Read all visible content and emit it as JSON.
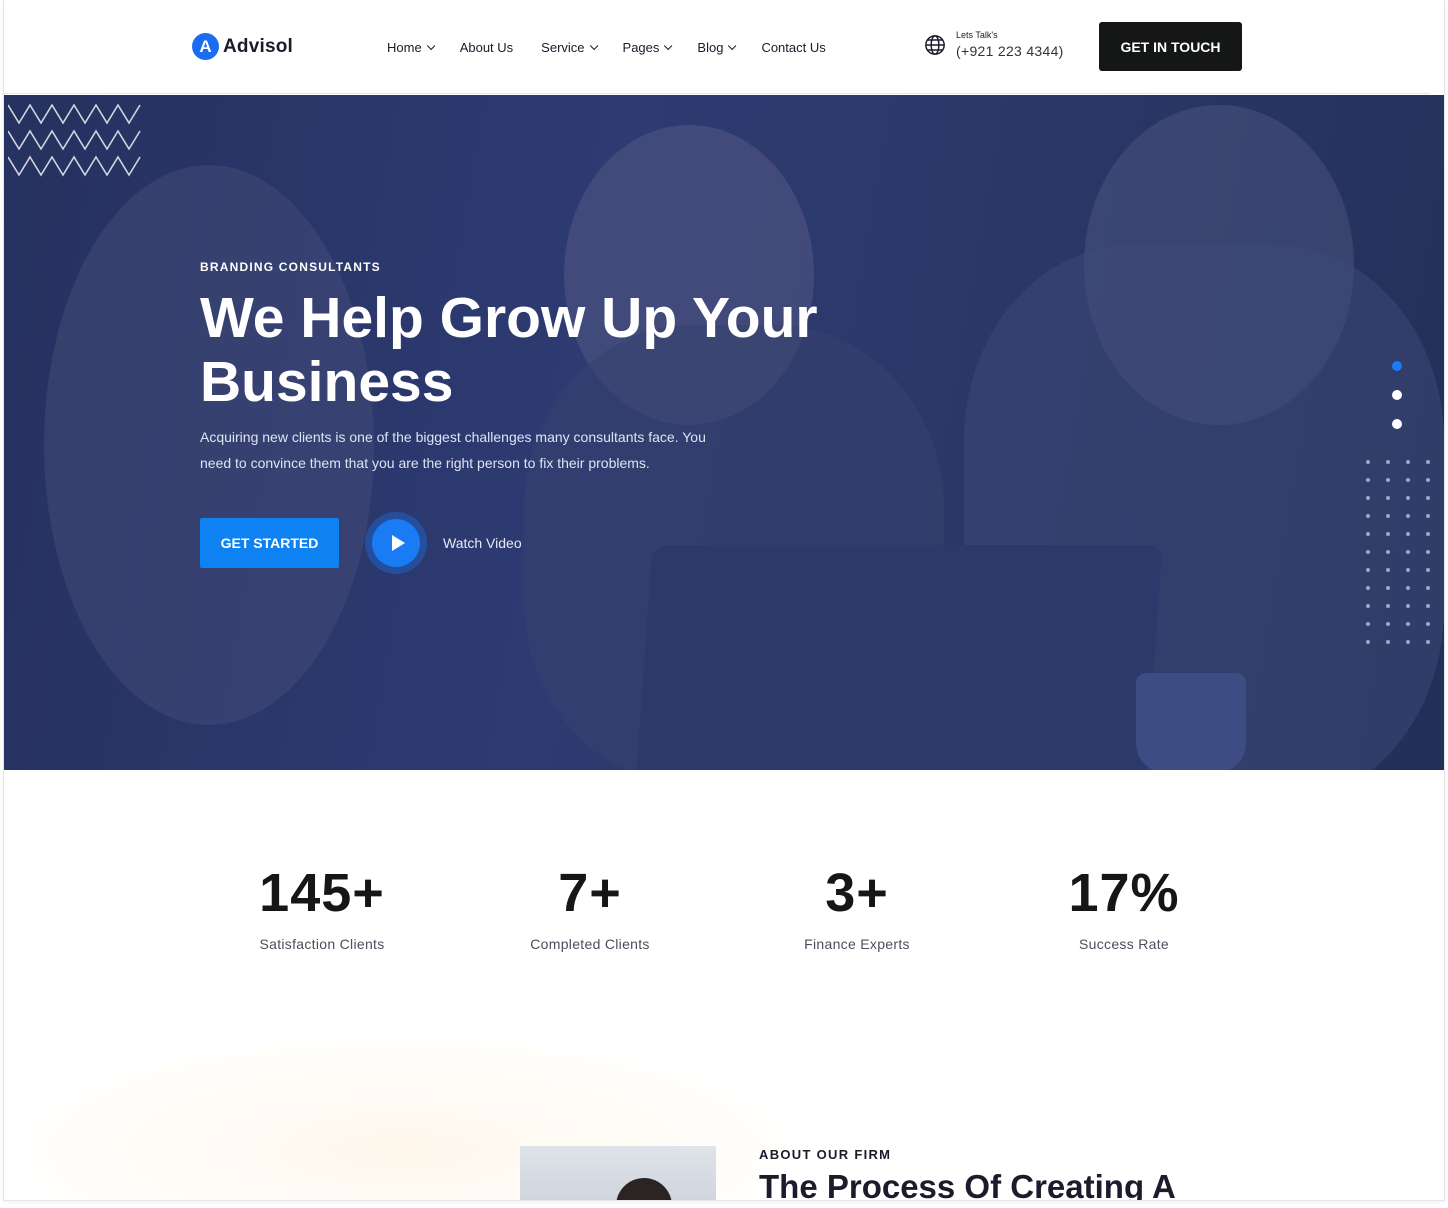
{
  "header": {
    "logo_letter": "A",
    "logo_text": "Advisol",
    "nav": [
      {
        "label": "Home",
        "dropdown": true
      },
      {
        "label": "About Us",
        "dropdown": false
      },
      {
        "label": "Service",
        "dropdown": true
      },
      {
        "label": "Pages",
        "dropdown": true
      },
      {
        "label": "Blog",
        "dropdown": true
      },
      {
        "label": "Contact Us",
        "dropdown": false
      }
    ],
    "contact_label": "Lets Talk's",
    "contact_phone": "(+921 223 4344)",
    "cta_label": "GET IN TOUCH"
  },
  "hero": {
    "eyebrow": "BRANDING CONSULTANTS",
    "title": "We Help Grow Up Your Business",
    "description": "Acquiring new clients is one of the biggest challenges many consultants face. You need to convince them that you are the right person to fix their problems.",
    "primary_button": "GET STARTED",
    "video_label": "Watch Video",
    "slides_total": 3,
    "active_slide": 1
  },
  "stats": [
    {
      "value": "145+",
      "label": "Satisfaction Clients"
    },
    {
      "value": "7+",
      "label": "Completed Clients"
    },
    {
      "value": "3+",
      "label": "Finance Experts"
    },
    {
      "value": "17%",
      "label": "Success Rate"
    }
  ],
  "about": {
    "eyebrow": "ABOUT OUR FIRM",
    "title": "The Process Of Creating A"
  },
  "colors": {
    "accent": "#0f82f3",
    "hero_overlay": "#2d3b72",
    "dark_button": "#151616"
  }
}
